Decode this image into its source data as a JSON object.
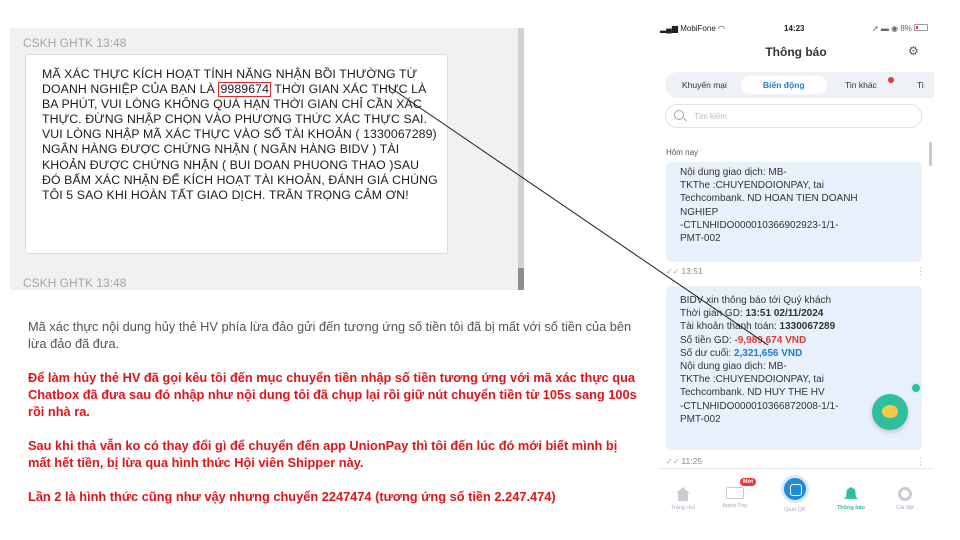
{
  "chat": {
    "sender_1": "CSKH GHTK 13:48",
    "sender_2": "CSKH GHTK 13:48",
    "message_before": "MÃ XÁC THỰC KÍCH HOẠT TÍNH NĂNG NHẬN BỒI THƯỜNG TỪ DOANH NGHIỆP CỦA BẠN LÀ ",
    "code": "9989674",
    "message_after": " THỜI GIAN XÁC THỰC LÀ BA PHÚT, VUI LÒNG KHÔNG QUÁ HẠN THỜI GIAN CHỈ CẦN XÁC THỰC. ĐỪNG NHẬP CHỌN VÀO PHƯƠNG THỨC XÁC THỰC SAI. VUI LÒNG NHẬP MÃ XÁC THỰC VÀO SỐ TÀI KHOẢN ( 1330067289) NGÂN HÀNG ĐƯỢC CHỨNG NHẬN ( NGÂN HÀNG BIDV ) TÀI KHOẢN ĐƯỢC CHỨNG NHẬN ( BUI DOAN PHUONG THAO )SAU ĐÓ BẤM XÁC NHẬN ĐỂ KÍCH HOẠT TÀI KHOẢN, ĐÁNH GIÁ CHÚNG TÔI 5 SAO KHI HOÀN TẤT GIAO DỊCH. TRÂN TRỌNG CẢM ƠN!"
  },
  "explanation": {
    "normal": "Mã xác thực nội dung hủy thẻ HV phía lừa đảo gửi đến tương ứng số tiền tôi đã bị mất với số tiền của bên lừa đảo đã đưa.",
    "red_1": "Để làm hủy thẻ HV đã gọi kêu tôi đến mục chuyển tiền nhập số tiền tương ứng với mã xác thực qua Chatbox đã đưa sau đó nhập như nội dung tôi đã chụp lại rồi giữ nút chuyển tiền từ 105s sang 100s rồi nhà ra.",
    "red_2": "Sau khi thả vẫn ko có thay đổi gì để chuyển đến app UnionPay thì tôi đến lúc đó mới biết mình bị mất hết tiền, bị lừa qua hình thức Hội viên Shipper này.",
    "red_3": "Lần 2 là hình thức cũng như vậy nhưng chuyển 2247474 (tương ứng số tiền 2.247.474)"
  },
  "phone": {
    "carrier": "MobiFone",
    "time": "14:23",
    "battery": "8%",
    "title": "Thông báo",
    "tabs": [
      "Khuyến mại",
      "Biến động",
      "Tin khác",
      "Ti"
    ],
    "search_placeholder": "Tìm kiếm",
    "section_label": "Hôm nay",
    "card_1_lines": [
      "Nội dung giao dịch: MB-",
      "TKThe :CHUYENDOIONPAY, tai",
      "Techcombank. ND  HOAN TIEN DOANH",
      "NGHIEP",
      "-CTLNHIDO000010366902923-1/1-",
      "PMT-002"
    ],
    "time_1": "13:51",
    "card_2": {
      "line_1": "BIDV xin thông báo tới Quý khách",
      "time_label": "Thời gian GD: ",
      "time_value": "13:51 02/11/2024",
      "account_label": "Tài khoản thanh toán: ",
      "account_value": "1330067289",
      "amount_label": "Số tiền GD: ",
      "amount_value": "-9,989,674 VND",
      "balance_label": "Số dư cuối: ",
      "balance_value": "2,321,656 VND",
      "lines": [
        "Nội dung giao dịch: MB-",
        "TKThe :CHUYENDOIONPAY, tai",
        "Techcombank. ND  HUY THE HV",
        "-CTLNHIDO000010366872008-1/1-",
        "PMT-002"
      ]
    },
    "time_2": "11:25",
    "nav": {
      "home": "Trang chủ",
      "applepay": "Apple Pay",
      "qr": "Quét QR",
      "notify": "Thông báo",
      "settings": "Cài đặt",
      "new_badge": "Mới"
    }
  },
  "colors": {
    "highlight_red": "#e1141a",
    "bidv_blue": "#1e7bd8",
    "accent_green": "#2fbf9d"
  }
}
